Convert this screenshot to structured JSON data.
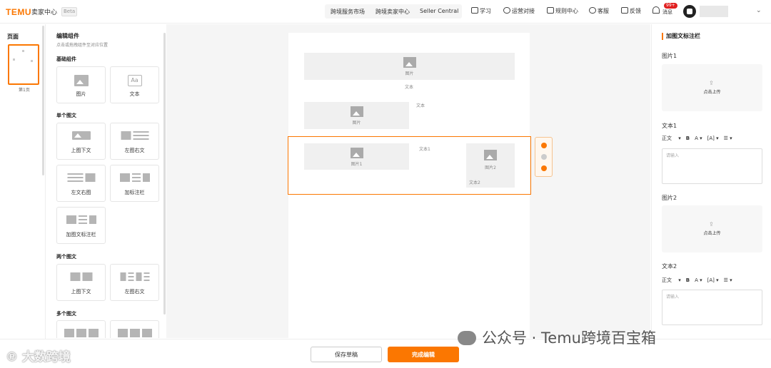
{
  "header": {
    "logo": "TEMU",
    "brand": "卖家中心",
    "beta": "Beta",
    "nav": [
      "跨境服务市场",
      "跨境卖家中心",
      "Seller Central"
    ],
    "tools": [
      "学习",
      "运营对接",
      "规则中心",
      "客服",
      "反馈"
    ],
    "messages_label": "消息",
    "messages_badge": "99+"
  },
  "pages": {
    "title": "页面",
    "items": [
      {
        "label": "第1页"
      }
    ]
  },
  "components": {
    "title": "编辑组件",
    "subtitle": "点击或拖拽组件至对应位置",
    "sections": {
      "basic": {
        "title": "基础组件",
        "items": [
          "图片",
          "文本"
        ]
      },
      "single": {
        "title": "单个图文",
        "items": [
          "上图下文",
          "左图右文",
          "左文右图",
          "加标注栏",
          "加图文标注栏"
        ]
      },
      "double": {
        "title": "两个图文",
        "items": [
          "上图下文",
          "左图右文"
        ]
      },
      "multi": {
        "title": "多个图文"
      }
    }
  },
  "canvas": {
    "block1": {
      "image": "图片",
      "text": "文本"
    },
    "block2": {
      "image": "图片",
      "text": "文本"
    },
    "block3": {
      "image1": "图片1",
      "text1": "文本1",
      "image2": "图片2",
      "text2": "文本2"
    }
  },
  "properties": {
    "title": "加图文标注栏",
    "image1_label": "图片1",
    "text1_label": "文本1",
    "image2_label": "图片2",
    "text2_label": "文本2",
    "upload_text": "点击上传",
    "format_style": "正文",
    "text_placeholder": "请输入"
  },
  "footer": {
    "save_draft": "保存草稿",
    "finish": "完成编辑"
  },
  "watermarks": {
    "left": "大数跨境",
    "right": "公众号 · Temu跨境百宝箱"
  },
  "colors": {
    "accent": "#fb7701",
    "badge": "#e02020"
  }
}
